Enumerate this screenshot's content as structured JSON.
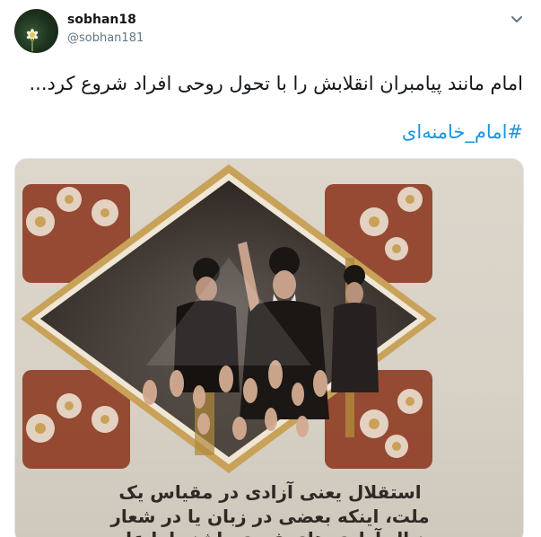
{
  "tweet": {
    "display_name": "sobhan18",
    "handle": "@sobhan181",
    "text": "امام مانند پیامبران انقلابش را با تحول روحی افراد شروع کرد...",
    "hashtag": "#امام_خامنه‌ای",
    "menu_icon": "chevron-down-icon"
  },
  "media": {
    "caption_lines": [
      "استقلال یعنی آزادی در مقیاس یک",
      "ملت، اینکه بعضی در زبان یا در شعار",
      "دنبال آزادی های فردی باشند اما علیه"
    ],
    "colors": {
      "background": "#d9d3c8",
      "frame_gold": "#c9a25a",
      "ornament_red": "#8e3b22"
    }
  }
}
